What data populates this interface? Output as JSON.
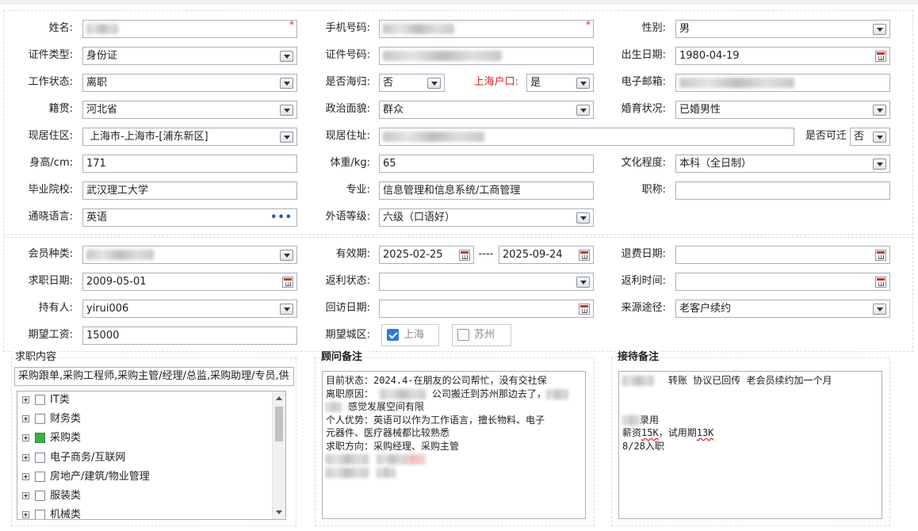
{
  "labels": {
    "name": "姓名:",
    "mobile": "手机号码:",
    "gender": "性别:",
    "id_type": "证件类型:",
    "id_number": "证件号码:",
    "birth_date": "出生日期:",
    "work_status": "工作状态:",
    "returnee": "是否海归:",
    "shanghai_hukou": "上海户口:",
    "email": "电子邮箱:",
    "native_place": "籍贯:",
    "political": "政治面貌:",
    "marital": "婚育状况:",
    "residence_area": "现居住区:",
    "residence_address": "现居住址:",
    "relocate": "是否可迁",
    "height": "身高/cm:",
    "weight": "体重/kg:",
    "education": "文化程度:",
    "school": "毕业院校:",
    "major": "专业:",
    "title": "职称:",
    "languages": "通晓语言:",
    "foreign_level": "外语等级:",
    "member_type": "会员种类:",
    "valid_period": "有效期:",
    "refund_date": "退费日期:",
    "job_date": "求职日期:",
    "rebate_status": "返利状态:",
    "rebate_time": "返利时间:",
    "holder": "持有人:",
    "visit_date": "回访日期:",
    "source": "来源途径:",
    "expected_salary": "期望工资:",
    "expected_city": "期望城区:"
  },
  "values": {
    "gender": "男",
    "id_type": "身份证",
    "birth_date": "1980-04-19",
    "work_status": "离职",
    "returnee": "否",
    "shanghai_hukou": "是",
    "native_place": "河北省",
    "political": "群众",
    "marital": "已婚男性",
    "residence_area": "上海市-上海市-[浦东新区]",
    "relocate": "否",
    "height": "171",
    "weight": "65",
    "education": "本科（全日制）",
    "school": "武汉理工大学",
    "major": "信息管理和信息系统/工商管理",
    "title": "",
    "languages": "英语",
    "foreign_level": "六级（口语好）",
    "valid_from": "2025-02-25",
    "valid_sep": "----",
    "valid_to": "2025-09-24",
    "refund_date": "",
    "job_date": "2009-05-01",
    "rebate_status": "",
    "rebate_time": "",
    "holder": "yirui006",
    "visit_date": "",
    "source": "老客户续约",
    "expected_salary": "15000"
  },
  "required_mark": "*",
  "cities": [
    {
      "label": "上海",
      "checked": true
    },
    {
      "label": "苏州",
      "checked": false
    }
  ],
  "job_content": {
    "legend": "求职内容",
    "selected_text": "采购跟单,采购工程师,采购主管/经理/总监,采购助理/专员,供",
    "tree": [
      {
        "label": "IT类",
        "state": "none"
      },
      {
        "label": "财务类",
        "state": "none"
      },
      {
        "label": "采购类",
        "state": "partial"
      },
      {
        "label": "电子商务/互联网",
        "state": "none"
      },
      {
        "label": "房地产/建筑/物业管理",
        "state": "none"
      },
      {
        "label": "服装类",
        "state": "none"
      },
      {
        "label": "机械类",
        "state": "none"
      }
    ]
  },
  "advisor_notes": {
    "legend": "顾问备注",
    "line1": "目前状态：2024.4-在朋友的公司帮忙，没有交社保",
    "line2a": "离职原因：",
    "line2b": "公司搬迁到苏州那边去了，",
    "line3b": "感觉发展空间有限",
    "line4": "个人优势：英语可以作为工作语言，擅长物料、电子",
    "line5": "元器件、医疗器械都比较熟悉",
    "line6": "求职方向：采购经理、采购主管"
  },
  "reception_notes": {
    "legend": "接待备注",
    "line1": "转账 协议已回传  老会员续约加一个月",
    "line3": "录用",
    "line4a": "薪资",
    "line4b": "15K",
    "line4c": "，试用期",
    "line4d": "13K",
    "line5": "8/28入职"
  }
}
